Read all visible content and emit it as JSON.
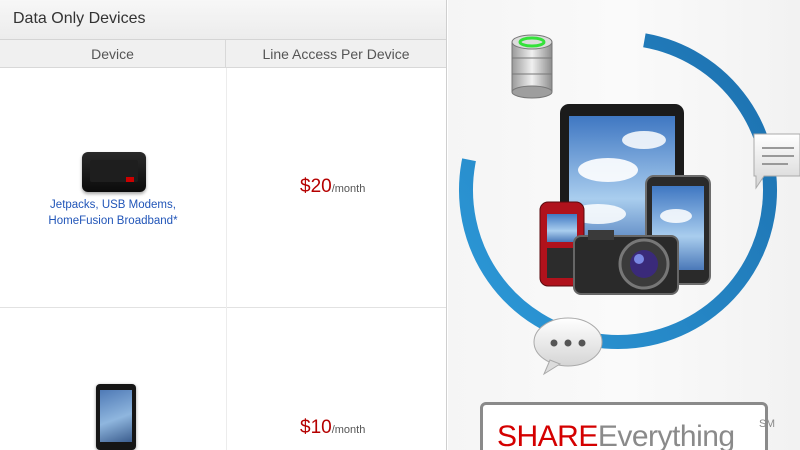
{
  "table": {
    "title": "Data Only Devices",
    "headers": {
      "device": "Device",
      "price": "Line Access Per Device"
    },
    "rows": [
      {
        "device_link_line1": "Jetpacks, USB Modems,",
        "device_link_line2": "HomeFusion Broadband*",
        "amount": "$20",
        "period": "/month",
        "image": "jetpack-hotspot"
      },
      {
        "amount": "$10",
        "period": "/month",
        "image": "tablet"
      }
    ]
  },
  "promo": {
    "brand_red": "SHARE",
    "brand_grey": "Everything",
    "brand_mark": "SM",
    "icons": [
      "database-icon",
      "message-bubble-icon",
      "chat-ellipsis-icon",
      "tablet-icon",
      "smartphone-icon",
      "flip-phone-icon",
      "camera-icon"
    ]
  },
  "colors": {
    "price_red": "#b50000",
    "brand_red": "#d40000",
    "link_blue": "#2155b8",
    "ring_blue": "#1e87c8"
  }
}
